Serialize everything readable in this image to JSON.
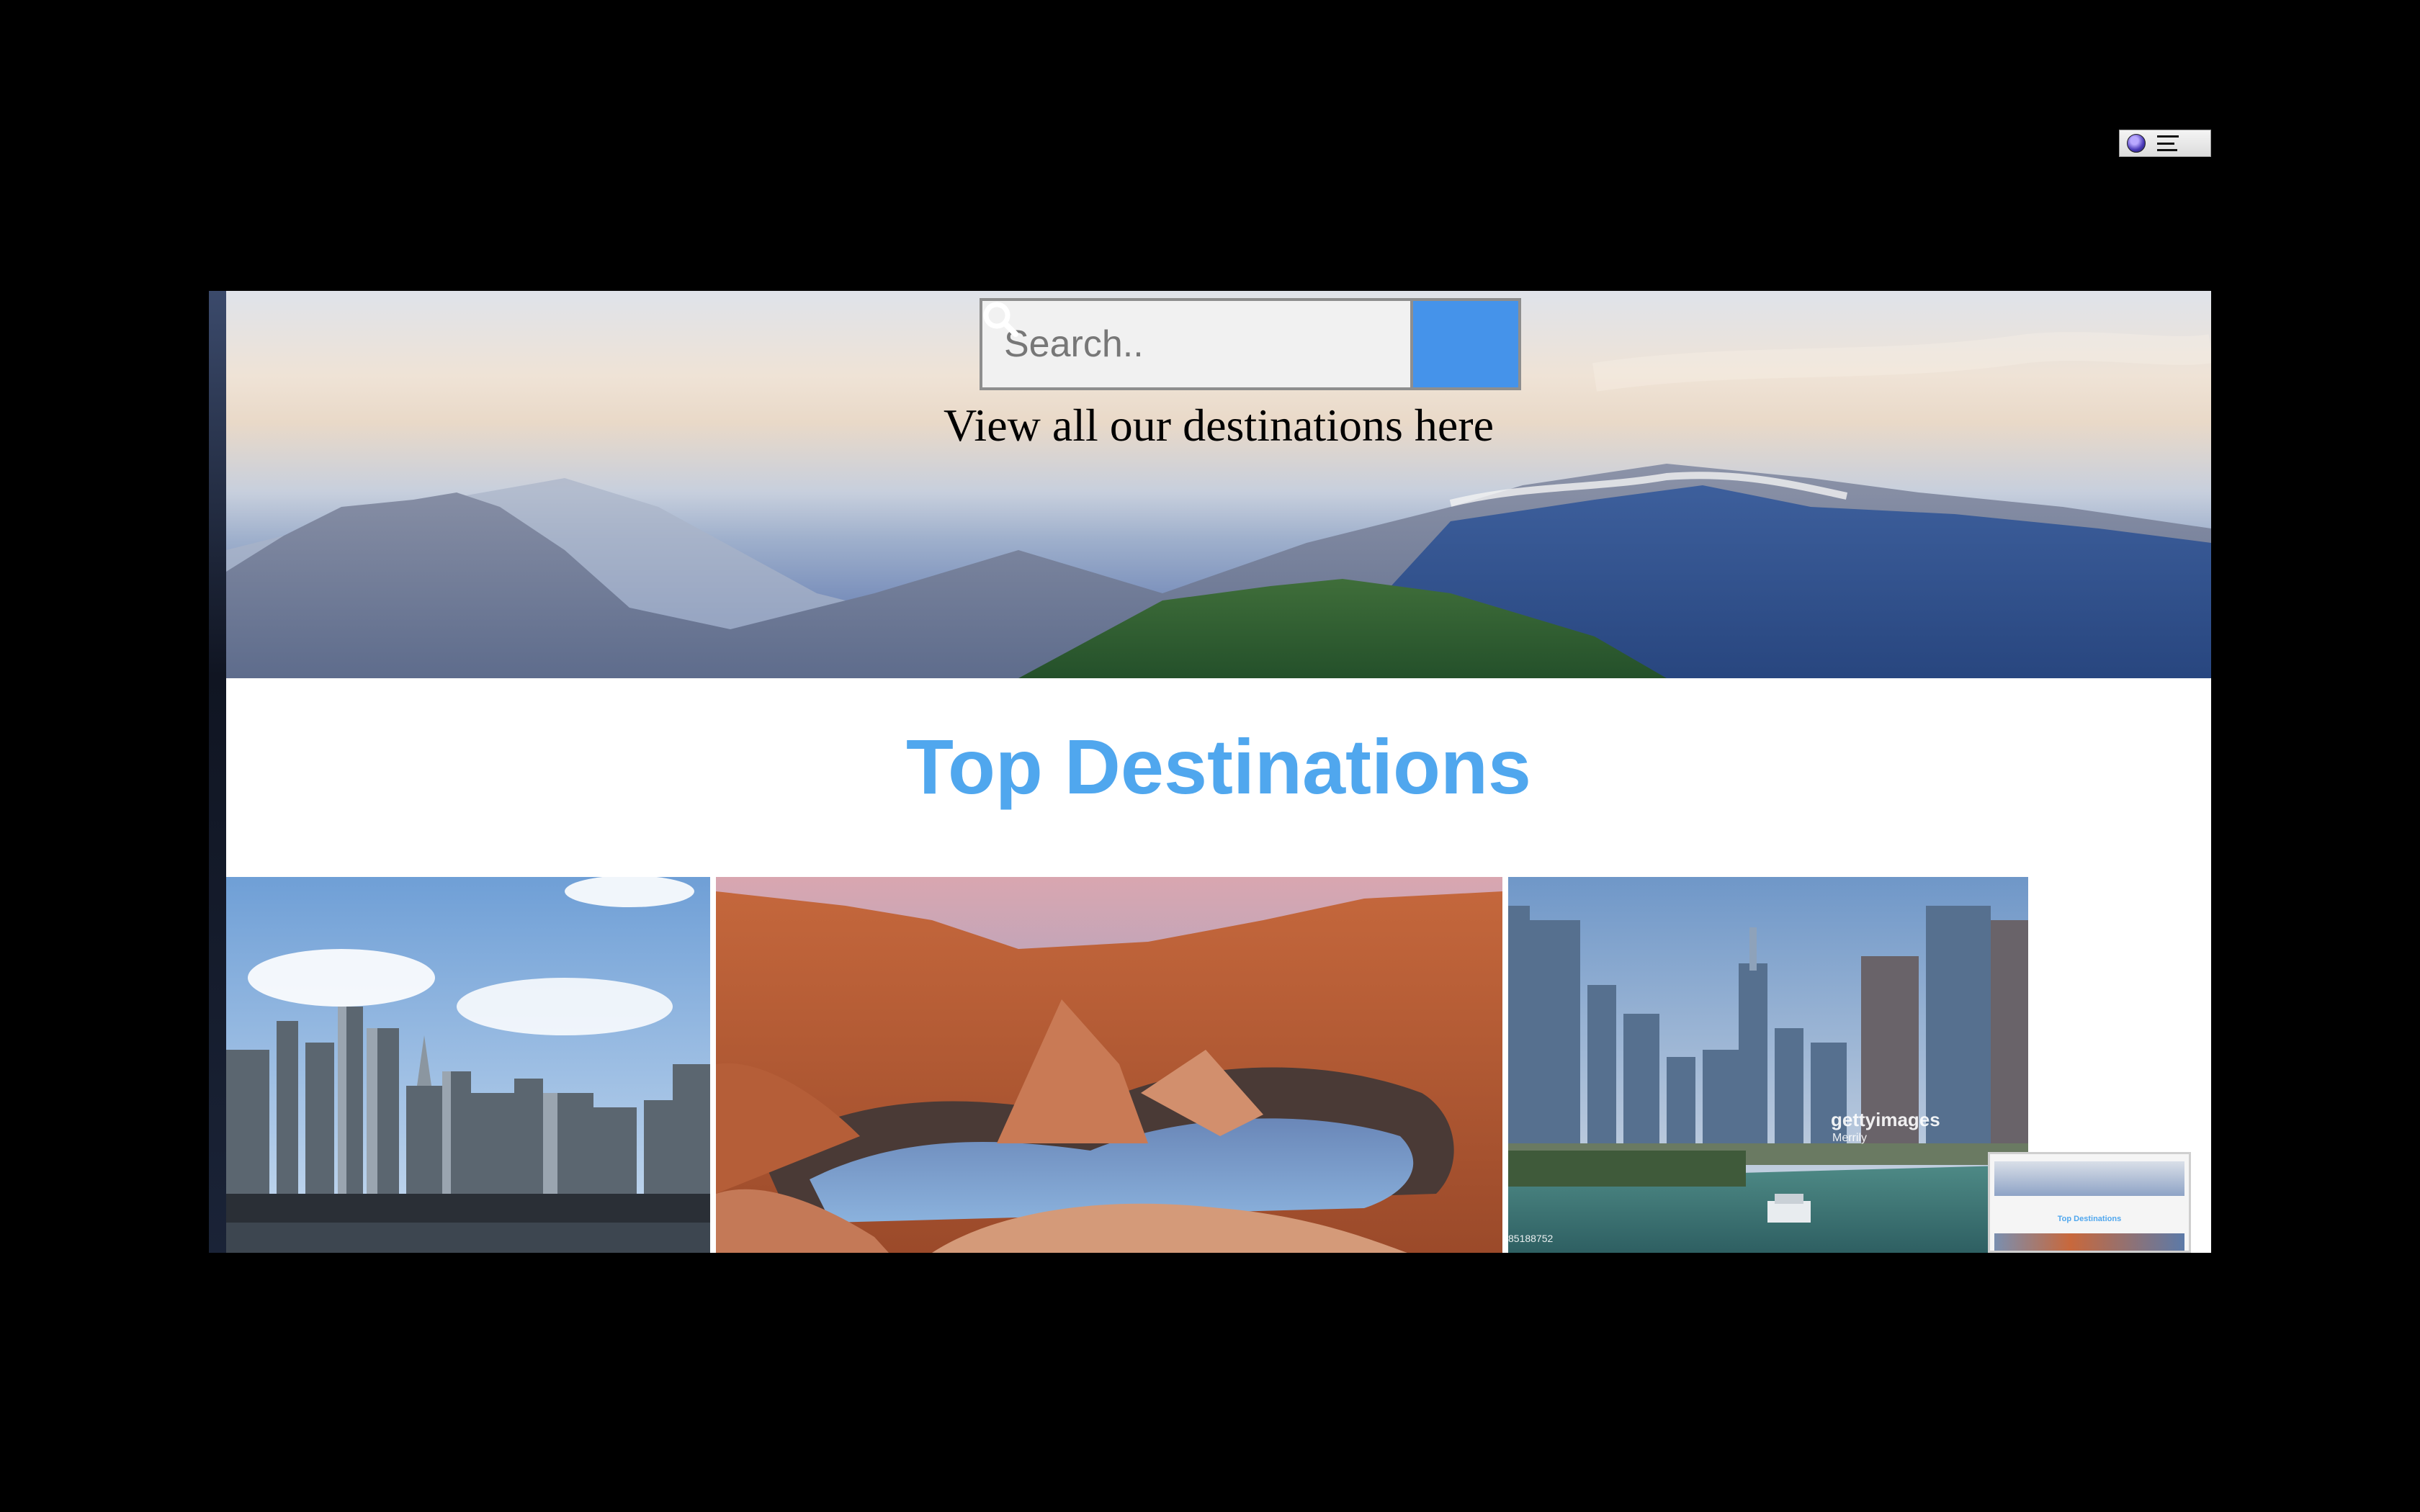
{
  "search": {
    "placeholder": "Search..",
    "button_icon": "search-icon"
  },
  "hero": {
    "caption": "View all our destinations here"
  },
  "destinations": {
    "title": "Top Destinations",
    "tiles": [
      {
        "name": "new-york-skyline"
      },
      {
        "name": "red-rock-canyon-lake"
      },
      {
        "name": "chicago-river",
        "watermark_brand": "gettyimages",
        "watermark_credit": "Merrily",
        "watermark_id": "85188752"
      }
    ]
  },
  "thumbnail": {
    "title": "Top Destinations"
  },
  "toolbar": {
    "icons": [
      "globe-icon",
      "list-icon"
    ]
  }
}
